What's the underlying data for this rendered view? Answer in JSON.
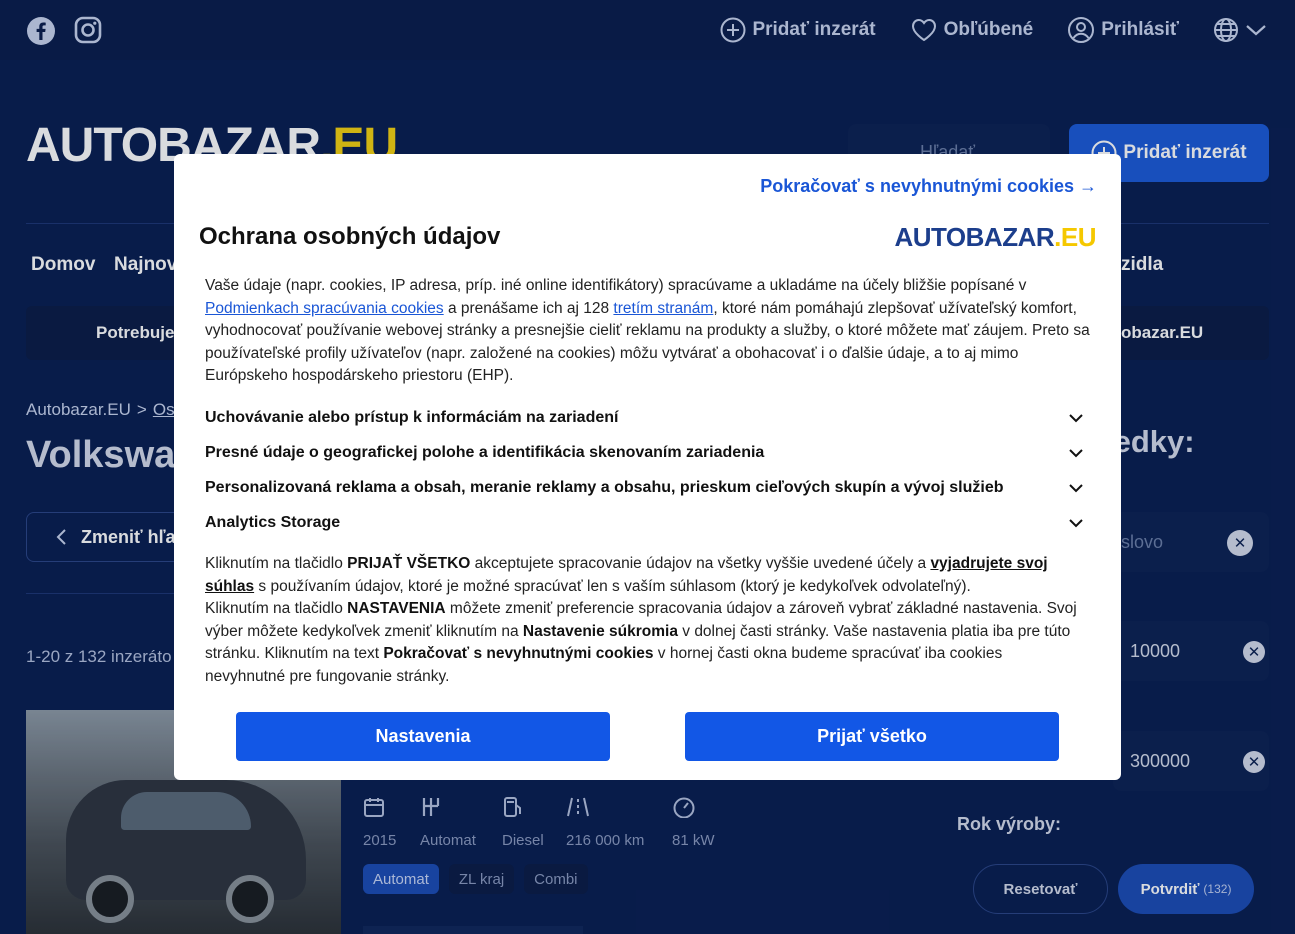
{
  "topbar": {
    "add_listing": "Pridať inzerát",
    "favorites": "Obľúbené",
    "login": "Prihlásiť"
  },
  "header": {
    "logo_part1": "AUTOBAZAR",
    "logo_part2": ".EU",
    "search_placeholder": "Hľadať",
    "add_listing_button": "Pridať inzerát"
  },
  "nav": {
    "home": "Domov",
    "newest": "Najnov",
    "vehicles": "zidla"
  },
  "banner": {
    "left": "Potrebuje",
    "right": "obazar.EU"
  },
  "breadcrumb": {
    "home": "Autobazar.EU",
    "sep": ">",
    "next": "Os"
  },
  "page": {
    "title": "Volkswag",
    "results_heading": "ledky:",
    "change_search": "Zmeniť hľa",
    "count": "1-20 z 132 inzeráto"
  },
  "filters": {
    "keyword_placeholder": "slovo",
    "price_from": "10000",
    "price_to": "300000",
    "year_label": "Rok výroby:",
    "reset": "Resetovať",
    "confirm": "Potvrdiť",
    "confirm_count": "(132)"
  },
  "listing": {
    "specs": [
      {
        "icon": "calendar-icon",
        "glyph": "▦",
        "value": "2015"
      },
      {
        "icon": "gearbox-icon",
        "glyph": "╫",
        "value": "Automat"
      },
      {
        "icon": "fuel-icon",
        "glyph": "⛽",
        "value": "Diesel"
      },
      {
        "icon": "road-icon",
        "glyph": "/ | \\",
        "value": "216 000 km"
      },
      {
        "icon": "speedometer-icon",
        "glyph": "◔",
        "value": "81 kW"
      }
    ],
    "tags": [
      "Automat",
      "ZL kraj",
      "Combi"
    ]
  },
  "modal": {
    "continue_link": "Pokračovať s nevyhnutnými cookies →",
    "title": "Ochrana osobných údajov",
    "logo_part1": "AUTOBAZAR",
    "logo_part2": ".EU",
    "intro_1": "Vaše údaje (napr. cookies, IP adresa, príp. iné online identifikátory) spracúvame a ukladáme na účely bližšie popísané v ",
    "intro_link1": "Podmienkach spracúvania cookies",
    "intro_2": " a prenášame ich aj 128 ",
    "intro_link2": "tretím stranám",
    "intro_3": ", ktoré nám pomáhajú zlepšovať užívateľský komfort, vyhodnocovať používanie webovej stránky a presnejšie cieliť reklamu na produkty a služby, o ktoré môžete mať záujem. Preto sa používateľské profily užívateľov (napr. založené na cookies) môžu vytvárať a obohacovať i o ďalšie údaje, a to aj mimo Európskeho hospodárskeho priestoru (EHP).",
    "purposes": [
      "Uchovávanie alebo prístup k informáciám na zariadení",
      "Presné údaje o geografickej polohe a identifikácia skenovaním zariadenia",
      "Personalizovaná reklama a obsah, meranie reklamy a obsahu, prieskum cieľových skupín a vývoj služieb",
      "Analytics Storage"
    ],
    "consent_p1_a": "Kliknutím na tlačidlo ",
    "consent_p1_b": "PRIJAŤ VŠETKO",
    "consent_p1_c": " akceptujete spracovanie údajov na všetky vyššie uvedené účely a ",
    "consent_p1_d": "vyjadrujete svoj súhlas",
    "consent_p1_e": " s používaním údajov, ktoré je možné spracúvať len s vaším súhlasom (ktorý je kedykoľvek odvolateľný).",
    "consent_p2_a": "Kliknutím na tlačidlo ",
    "consent_p2_b": "NASTAVENIA",
    "consent_p2_c": " môžete zmeniť preferencie spracovania údajov a zároveň vybrať základné nastavenia. Svoj výber môžete kedykoľvek zmeniť kliknutím na ",
    "consent_p2_d": "Nastavenie súkromia",
    "consent_p2_e": " v dolnej časti stránky. Vaše nastavenia platia iba pre túto stránku. Kliknutím na text ",
    "consent_p2_f": "Pokračovať s nevyhnutnými cookies",
    "consent_p2_g": " v hornej časti okna budeme spracúvať iba cookies nevyhnutné pre fungovanie stránky.",
    "settings_button": "Nastavenia",
    "accept_button": "Prijať všetko"
  },
  "colors": {
    "page_bg": "#0a1f52",
    "primary_button": "#1257e6",
    "link": "#1a56d6",
    "logo_yellow": "#f5c800"
  }
}
